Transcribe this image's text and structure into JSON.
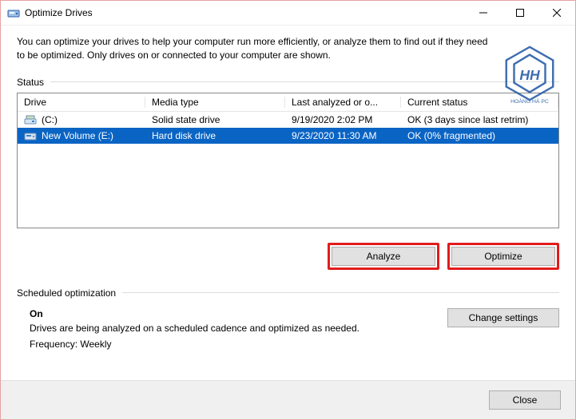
{
  "window": {
    "title": "Optimize Drives"
  },
  "intro": "You can optimize your drives to help your computer run more efficiently, or analyze them to find out if they need to be optimized. Only drives on or connected to your computer are shown.",
  "status": {
    "label": "Status",
    "columns": {
      "drive": "Drive",
      "media": "Media type",
      "last": "Last analyzed or o...",
      "cur": "Current status"
    },
    "rows": [
      {
        "selected": false,
        "icon": "drive-c-icon",
        "name": "(C:)",
        "media": "Solid state drive",
        "last": "9/19/2020 2:02 PM",
        "cur": "OK (3 days since last retrim)"
      },
      {
        "selected": true,
        "icon": "drive-hdd-icon",
        "name": "New Volume (E:)",
        "media": "Hard disk drive",
        "last": "9/23/2020 11:30 AM",
        "cur": "OK (0% fragmented)"
      }
    ]
  },
  "buttons": {
    "analyze": "Analyze",
    "optimize": "Optimize",
    "change": "Change settings",
    "close": "Close"
  },
  "schedule": {
    "label": "Scheduled optimization",
    "state": "On",
    "desc": "Drives are being analyzed on a scheduled cadence and optimized as needed.",
    "freq": "Frequency: Weekly"
  },
  "watermark": {
    "brand": "HOÀNG HÀ PC",
    "color": "#2a5ea8"
  },
  "highlight_color": "#e21b1b"
}
